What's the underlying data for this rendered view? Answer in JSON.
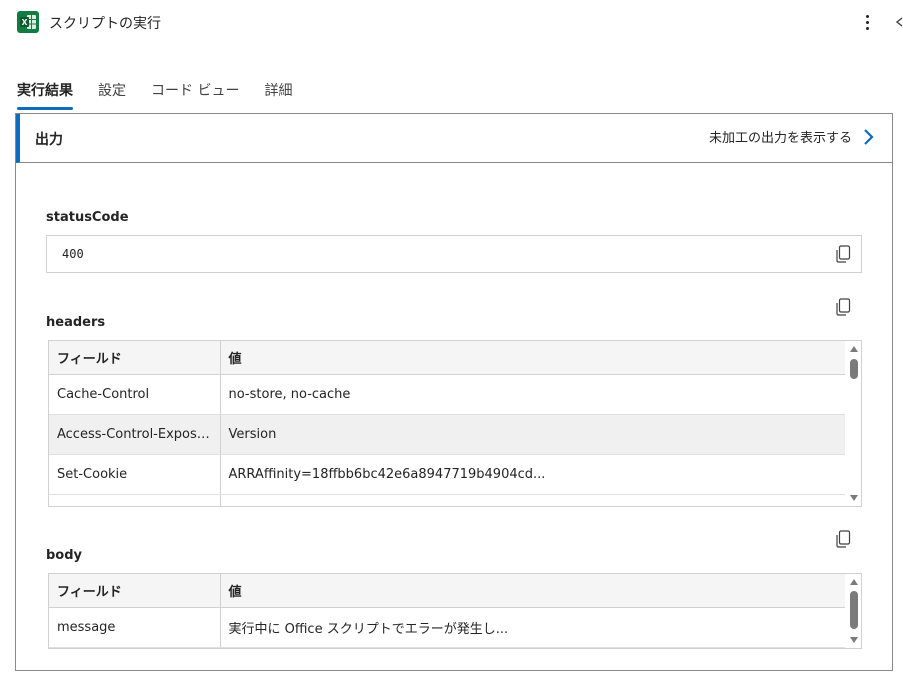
{
  "header": {
    "title": "スクリプトの実行",
    "app_icon": "excel-icon"
  },
  "tabs": [
    {
      "label": "実行結果",
      "active": true
    },
    {
      "label": "設定",
      "active": false
    },
    {
      "label": "コード ビュー",
      "active": false
    },
    {
      "label": "詳細",
      "active": false
    }
  ],
  "output": {
    "title": "出力",
    "raw_link": "未加工の出力を表示する",
    "accent": "#0f6cbd",
    "status": {
      "label": "statusCode",
      "value": "400"
    },
    "headers": {
      "label": "headers",
      "columns": [
        "フィールド",
        "値"
      ],
      "rows": [
        [
          "Cache-Control",
          "no-store, no-cache"
        ],
        [
          "Access-Control-Expose...",
          "Version"
        ],
        [
          "Set-Cookie",
          "ARRAffinity=18ffbb6bc42e6a8947719b4904cd..."
        ],
        [
          "",
          ""
        ]
      ]
    },
    "body": {
      "label": "body",
      "columns": [
        "フィールド",
        "値"
      ],
      "rows": [
        [
          "message",
          "実行中に Office スクリプトでエラーが発生し..."
        ]
      ]
    }
  }
}
